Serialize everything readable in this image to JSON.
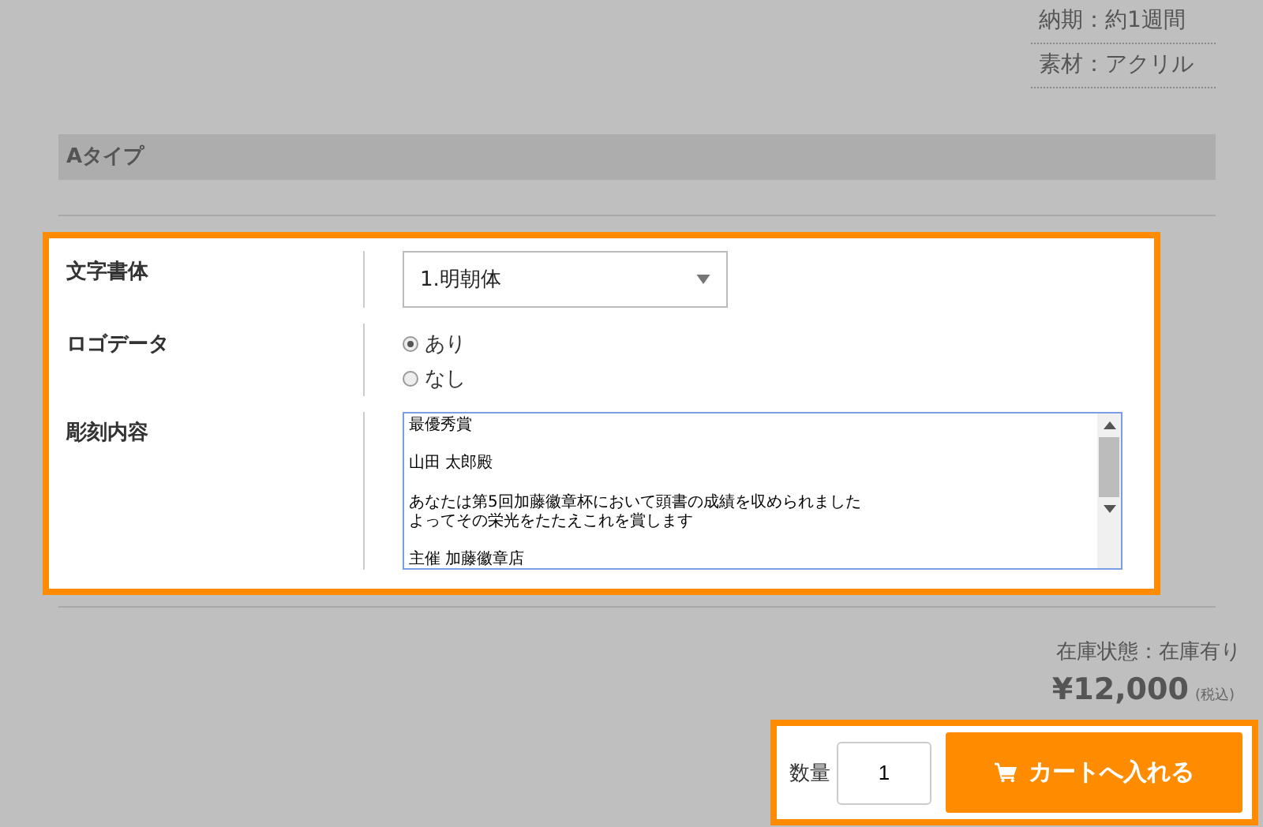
{
  "specs": [
    {
      "text": "納期：約1週間"
    },
    {
      "text": "素材：アクリル"
    }
  ],
  "section_title": "Aタイプ",
  "options": [
    {
      "kind": "select",
      "label": "文字書体",
      "value": "1.明朝体"
    },
    {
      "kind": "radio",
      "label": "ロゴデータ",
      "choices": [
        {
          "label": "あり",
          "selected": true
        },
        {
          "label": "なし",
          "selected": false
        }
      ]
    },
    {
      "kind": "textarea",
      "label": "彫刻内容",
      "lines": [
        {
          "text": "最優秀賞",
          "blank_before": false
        },
        {
          "text": "山田 太郎殿",
          "blank_before": true
        },
        {
          "text": "あなたは第5回加藤徽章杯において頭書の成績を収められました",
          "blank_before": true
        },
        {
          "text": "よってその栄光をたたえこれを賞します",
          "blank_before": false
        },
        {
          "text": "主催 加藤徽章店",
          "blank_before": true
        }
      ]
    }
  ],
  "stock": "在庫状態：在庫有り",
  "price": "¥12,000",
  "tax_note": "(税込)",
  "quantity_label": "数量",
  "quantity": "1",
  "cart_button": "カートへ入れる"
}
